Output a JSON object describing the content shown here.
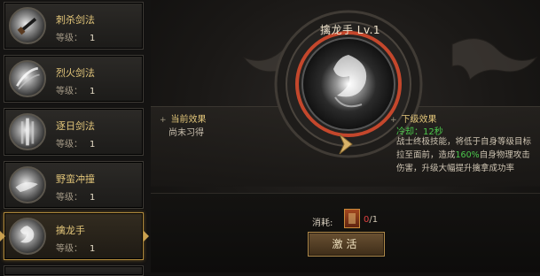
{
  "skills": [
    {
      "name": "刺杀剑法",
      "level_label": "等级：",
      "level": "1",
      "icon": "sword-thrust-icon"
    },
    {
      "name": "烈火剑法",
      "level_label": "等级：",
      "level": "1",
      "icon": "fire-slash-icon"
    },
    {
      "name": "逐日剑法",
      "level_label": "等级：",
      "level": "1",
      "icon": "sun-chase-sword-icon"
    },
    {
      "name": "野蛮冲撞",
      "level_label": "等级：",
      "level": "1",
      "icon": "savage-charge-icon"
    },
    {
      "name": "擒龙手",
      "level_label": "等级：",
      "level": "1",
      "icon": "dragon-grab-icon"
    }
  ],
  "selected_skill_index": 4,
  "detail": {
    "title": "擒龙手 Lv.1",
    "current_effect_title": "当前效果",
    "current_effect_text": "尚未习得",
    "next_effect_title": "下级效果",
    "cooldown": "冷却：12秒",
    "desc_part1": "战士终极技能，将低于自身等级目标拉至面前，造成",
    "desc_highlight": "160%",
    "desc_part2": "自身物理攻击伤害，升级大幅提升擒拿成功率"
  },
  "cost": {
    "label": "消耗:",
    "have": "0",
    "separator": "/",
    "need": "1",
    "item_icon": "skill-book-icon"
  },
  "activate_button": "激活",
  "colors": {
    "gold_text": "#e3c67a",
    "green_highlight": "#4cc84c",
    "red_count": "#e04040",
    "medallion_ring": "#c4472c"
  }
}
